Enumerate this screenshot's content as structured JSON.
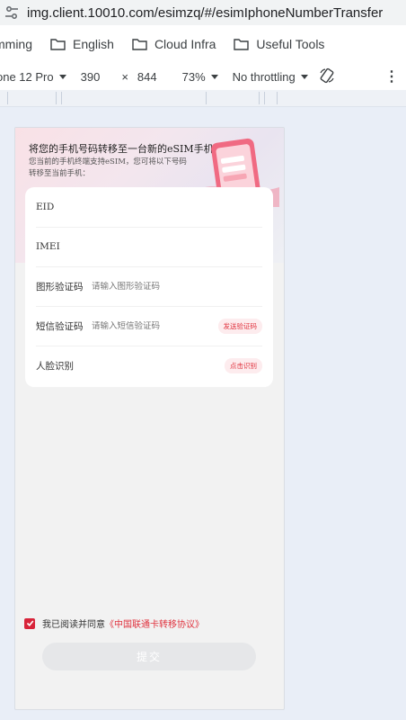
{
  "browser": {
    "url": "img.client.10010.com/esimzq/#/esimIphoneNumberTransfer",
    "bookmarks": [
      {
        "label": "mming",
        "icon": "folder-icon"
      },
      {
        "label": "English",
        "icon": "folder-icon"
      },
      {
        "label": "Cloud Infra",
        "icon": "folder-icon"
      },
      {
        "label": "Useful Tools",
        "icon": "folder-icon"
      }
    ]
  },
  "devtools": {
    "device": "one 12 Pro",
    "width": "390",
    "times": "×",
    "height": "844",
    "zoom": "73%",
    "throttle": "No throttling",
    "more": "⋮"
  },
  "page": {
    "title": "将您的手机号码转移至一台新的eSIM手机",
    "subtitle": "您当前的手机终端支持eSIM，您可将以下号码转移至当前手机：",
    "form": {
      "eid_label": "EID",
      "imei_label": "IMEI",
      "captcha_label": "图形验证码",
      "captcha_placeholder": "请输入图形验证码",
      "sms_label": "短信验证码",
      "sms_placeholder": "请输入短信验证码",
      "sms_button": "发送验证码",
      "face_label": "人脸识别",
      "face_button": "点击识别"
    },
    "agreement_text": "我已阅读并同意",
    "agreement_link": "《中国联通卡转移协议》",
    "submit_label": "提交",
    "accent_color": "#e0333f"
  }
}
